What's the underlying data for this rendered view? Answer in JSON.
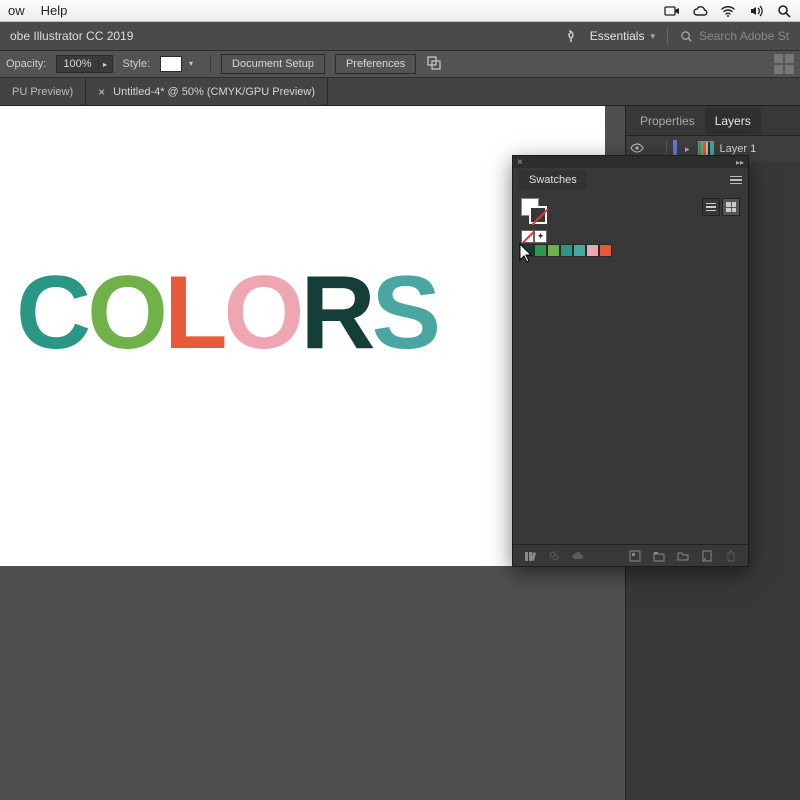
{
  "mac_menu": {
    "item1": "ow",
    "item2": "Help"
  },
  "app": {
    "title": "obe Illustrator CC 2019",
    "workspace": "Essentials",
    "search_placeholder": "Search Adobe St"
  },
  "controlbar": {
    "opacity_label": "Opacity:",
    "opacity_value": "100%",
    "style_label": "Style:",
    "doc_setup": "Document Setup",
    "preferences": "Preferences"
  },
  "tabs": {
    "t1": "PU Preview)",
    "t2": "Untitled-4* @ 50% (CMYK/GPU Preview)"
  },
  "artwork": {
    "letters": [
      {
        "ch": "C",
        "color": "#2a9686"
      },
      {
        "ch": "O",
        "color": "#6fb24a"
      },
      {
        "ch": "L",
        "color": "#e85a3a"
      },
      {
        "ch": "O",
        "color": "#eea7b2"
      },
      {
        "ch": "R",
        "color": "#153e38"
      },
      {
        "ch": "S",
        "color": "#4aa6a0"
      }
    ]
  },
  "rightpanel": {
    "tab_properties": "Properties",
    "tab_layers": "Layers",
    "layer1": "Layer 1"
  },
  "swatches": {
    "title": "Swatches",
    "colors": [
      "#153e38",
      "#2a9b4e",
      "#6fb24a",
      "#2a9686",
      "#4aa6a0",
      "#eea7b2",
      "#e85a3a"
    ]
  }
}
